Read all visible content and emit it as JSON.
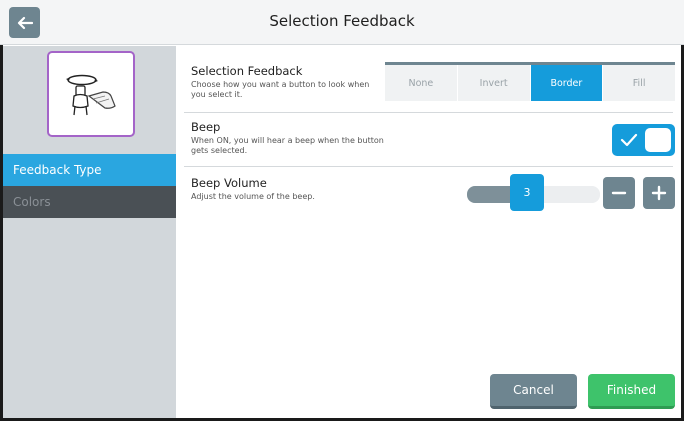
{
  "header": {
    "title": "Selection Feedback"
  },
  "sidebar": {
    "items": [
      {
        "label": "Feedback Type",
        "active": true
      },
      {
        "label": "Colors",
        "active": false
      }
    ]
  },
  "settings": {
    "selection_feedback": {
      "title": "Selection Feedback",
      "description": "Choose how you want a button to look when you select it.",
      "options": [
        "None",
        "Invert",
        "Border",
        "Fill"
      ],
      "selected": "Border"
    },
    "beep": {
      "title": "Beep",
      "description": "When ON, you will hear a beep when the button gets selected.",
      "enabled": true
    },
    "beep_volume": {
      "title": "Beep Volume",
      "description": "Adjust the volume of the beep.",
      "value": "3",
      "fraction": 0.45
    }
  },
  "footer": {
    "cancel_label": "Cancel",
    "finished_label": "Finished"
  },
  "colors": {
    "accent": "#159cdb",
    "primary_gray": "#6e8590",
    "success": "#3ec36b",
    "preview_border": "#a464c8"
  }
}
